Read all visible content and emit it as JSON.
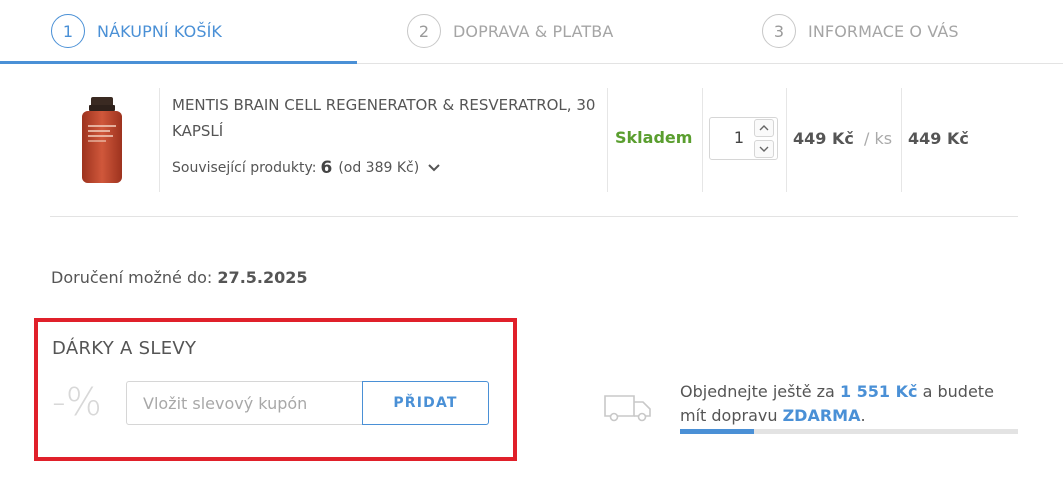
{
  "steps": [
    {
      "number": "1",
      "label": "NÁKUPNÍ KOŠÍK",
      "active": true
    },
    {
      "number": "2",
      "label": "DOPRAVA & PLATBA",
      "active": false
    },
    {
      "number": "3",
      "label": "INFORMACE O VÁS",
      "active": false
    }
  ],
  "cart": {
    "product_name": "MENTIS BRAIN CELL REGENERATOR & RESVERATROL, 30 KAPSLÍ",
    "related_label": "Související produkty:",
    "related_count": "6",
    "related_price_from": "(od 389 Kč)",
    "stock_status": "Skladem",
    "quantity": "1",
    "unit_price": "449 Kč",
    "per_unit": "/ ks",
    "total_price": "449 Kč",
    "image_label_text": "Mentis Brain Cell Regenerator & Resveratrol"
  },
  "delivery": {
    "label": "Doručení možné do:",
    "date": "27.5.2025"
  },
  "gifts": {
    "title": "DÁRKY A SLEVY",
    "percent_symbol": "-%",
    "coupon_placeholder": "Vložit slevový kupón",
    "add_button": "PŘIDAT"
  },
  "shipping": {
    "text_before": "Objednejte ještě za",
    "amount": "1 551 Kč",
    "text_middle": "a budete mít dopravu",
    "free_label": "ZDARMA",
    "text_end": ".",
    "progress_fraction": 0.22
  },
  "colors": {
    "accent": "#4a90d6",
    "stock_green": "#5a9e2f",
    "highlight_red": "#e0202a"
  }
}
